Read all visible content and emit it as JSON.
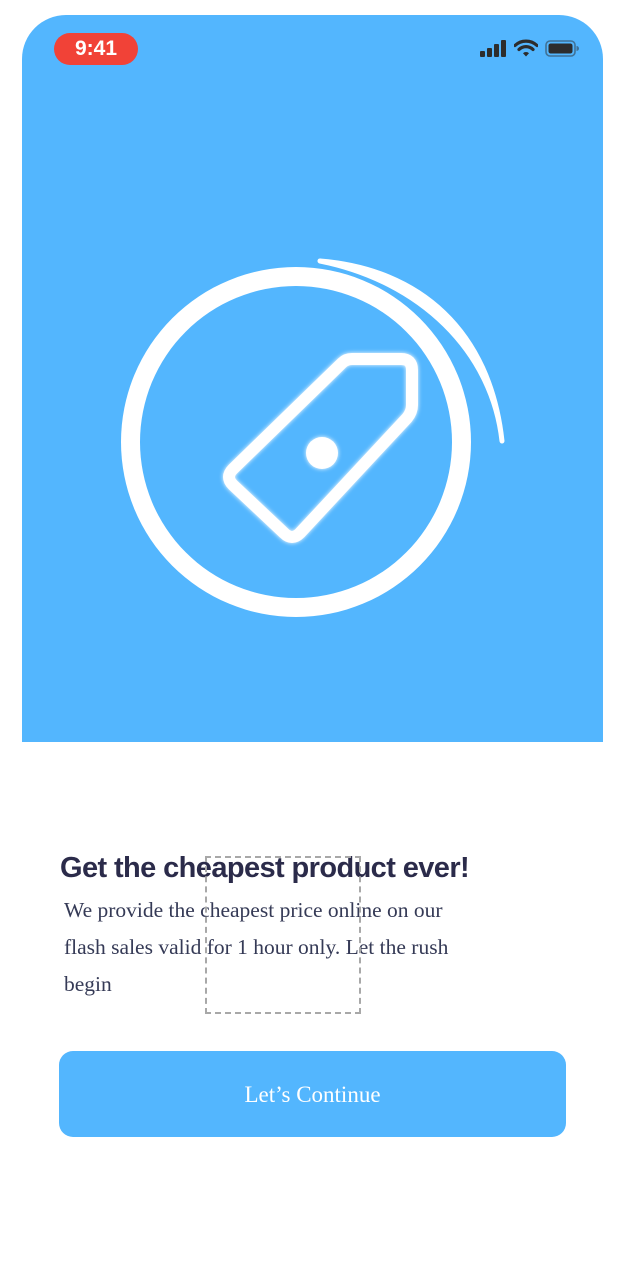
{
  "status_bar": {
    "time": "9:41",
    "time_pill_color": "#f14237",
    "icons": [
      "cellular-signal-icon",
      "wifi-icon",
      "battery-icon"
    ]
  },
  "hero": {
    "background_color": "#53b6fe",
    "illustration_icon": "price-tag-icon"
  },
  "onboarding": {
    "title": "Get the cheapest product ever!",
    "description": "We provide the cheapest price online on our flash sales valid for 1 hour only. Let the rush begin"
  },
  "cta": {
    "label": "Let’s Continue",
    "color": "#53b6fe"
  }
}
